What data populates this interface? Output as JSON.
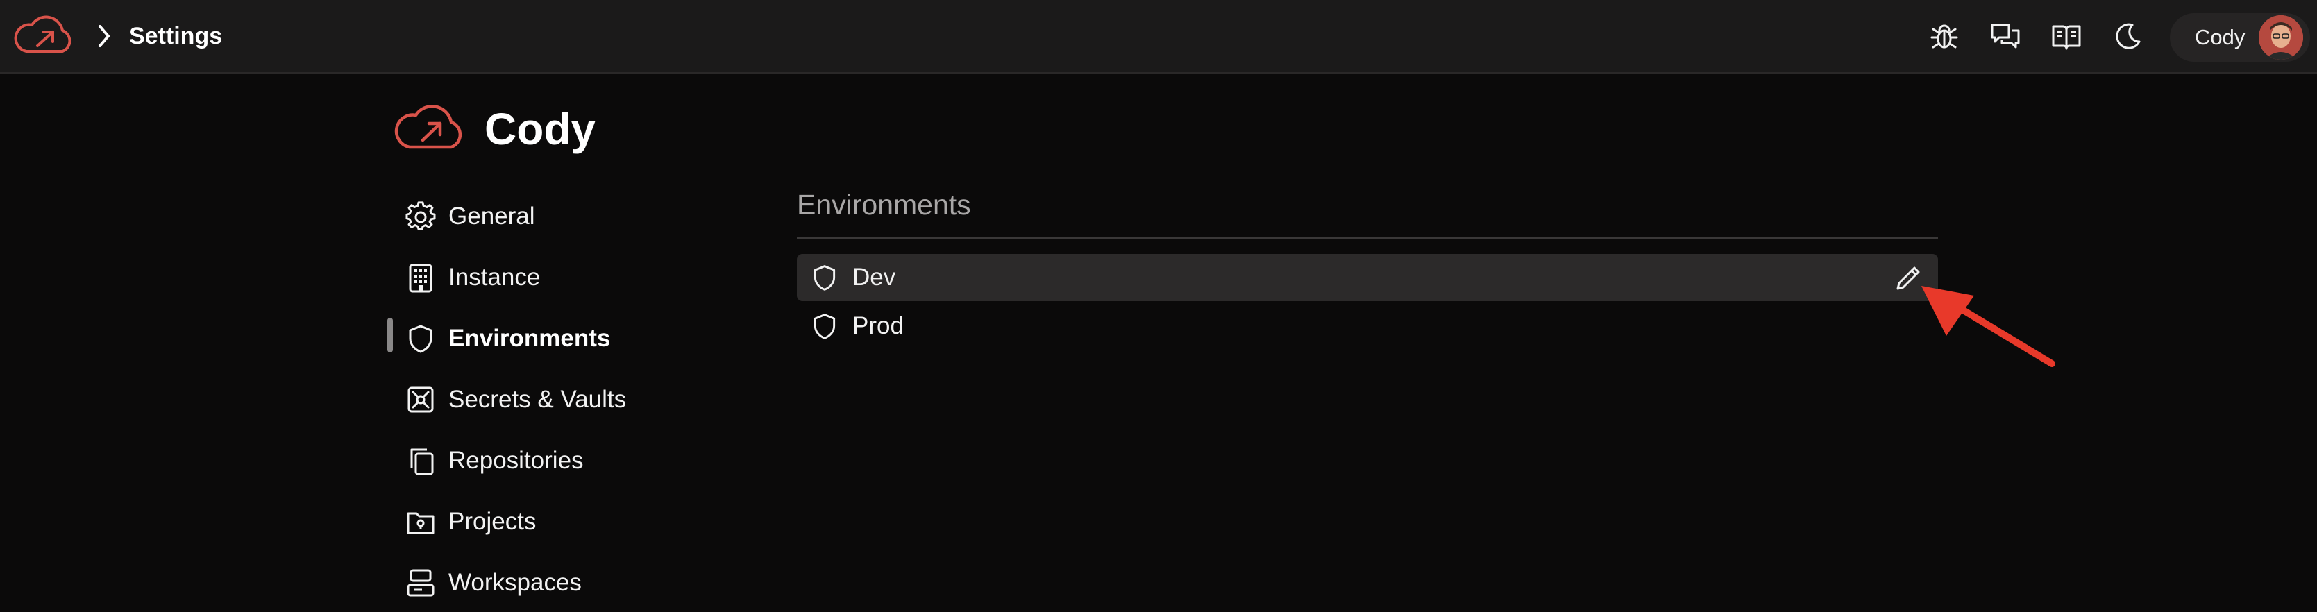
{
  "topbar": {
    "breadcrumb_title": "Settings",
    "icons": [
      "cloud-logo",
      "chevron-right-icon",
      "bug-icon",
      "chat-icon",
      "book-icon",
      "moon-icon"
    ],
    "user": {
      "name": "Cody"
    }
  },
  "org": {
    "name": "Cody"
  },
  "sidebar": {
    "items": [
      {
        "label": "General",
        "icon": "gear-icon"
      },
      {
        "label": "Instance",
        "icon": "building-icon"
      },
      {
        "label": "Environments",
        "icon": "shield-icon",
        "active": true
      },
      {
        "label": "Secrets & Vaults",
        "icon": "vault-icon"
      },
      {
        "label": "Repositories",
        "icon": "repositories-icon"
      },
      {
        "label": "Projects",
        "icon": "folder-icon"
      },
      {
        "label": "Workspaces",
        "icon": "workspaces-icon"
      }
    ]
  },
  "main": {
    "section_title": "Environments",
    "environments": [
      {
        "name": "Dev",
        "hovered": true
      },
      {
        "name": "Prod"
      }
    ]
  },
  "colors": {
    "brand": "#d9534a",
    "background": "#0b0a0a",
    "topbar": "#1b1a1a",
    "annotation_arrow": "#e8392a"
  }
}
